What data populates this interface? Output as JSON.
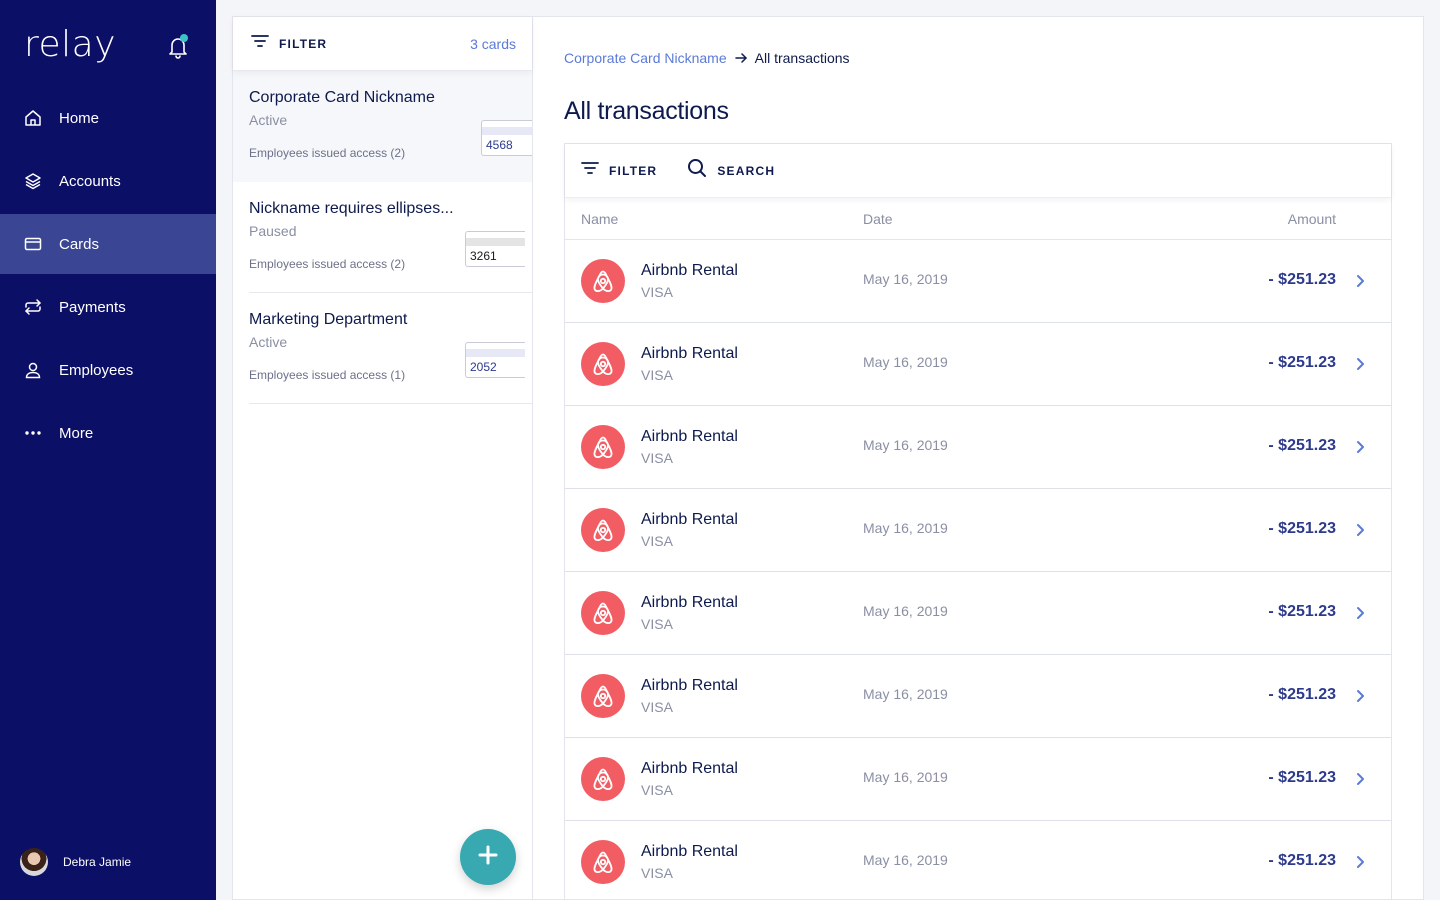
{
  "app": {
    "logo": "relay"
  },
  "sidebar": {
    "items": [
      {
        "label": "Home",
        "icon": "home-icon",
        "active": false
      },
      {
        "label": "Accounts",
        "icon": "layers-icon",
        "active": false
      },
      {
        "label": "Cards",
        "icon": "credit-card-icon",
        "active": true
      },
      {
        "label": "Payments",
        "icon": "swap-arrows-icon",
        "active": false
      },
      {
        "label": "Employees",
        "icon": "user-icon",
        "active": false
      },
      {
        "label": "More",
        "icon": "more-dots-icon",
        "active": false
      }
    ],
    "user": {
      "name": "Debra Jamie"
    }
  },
  "cards_panel": {
    "filter_label": "FILTER",
    "count_label": "3 cards",
    "cards": [
      {
        "title": "Corporate Card Nickname",
        "status": "Active",
        "access": "Employees issued access (2)",
        "last4": "4568"
      },
      {
        "title": "Nickname requires ellipses...",
        "status": "Paused",
        "access": "Employees issued access (2)",
        "last4": "3261"
      },
      {
        "title": "Marketing Department",
        "status": "Active",
        "access": "Employees issued access (1)",
        "last4": "2052"
      }
    ]
  },
  "main": {
    "breadcrumb": {
      "parent": "Corporate Card Nickname",
      "current": "All transactions"
    },
    "title": "All transactions",
    "toolbar": {
      "filter_label": "FILTER",
      "search_label": "SEARCH"
    },
    "columns": {
      "name": "Name",
      "date": "Date",
      "amount": "Amount"
    },
    "transactions": [
      {
        "name": "Airbnb Rental",
        "method": "VISA",
        "date": "May 16, 2019",
        "amount": "- $251.23"
      },
      {
        "name": "Airbnb Rental",
        "method": "VISA",
        "date": "May 16, 2019",
        "amount": "- $251.23"
      },
      {
        "name": "Airbnb Rental",
        "method": "VISA",
        "date": "May 16, 2019",
        "amount": "- $251.23"
      },
      {
        "name": "Airbnb Rental",
        "method": "VISA",
        "date": "May 16, 2019",
        "amount": "- $251.23"
      },
      {
        "name": "Airbnb Rental",
        "method": "VISA",
        "date": "May 16, 2019",
        "amount": "- $251.23"
      },
      {
        "name": "Airbnb Rental",
        "method": "VISA",
        "date": "May 16, 2019",
        "amount": "- $251.23"
      },
      {
        "name": "Airbnb Rental",
        "method": "VISA",
        "date": "May 16, 2019",
        "amount": "- $251.23"
      },
      {
        "name": "Airbnb Rental",
        "method": "VISA",
        "date": "May 16, 2019",
        "amount": "- $251.23"
      }
    ]
  },
  "colors": {
    "sidebar_bg": "#0c0f66",
    "active_nav": "#3a4694",
    "accent": "#5b7ad8",
    "merchant_logo": "#f25c63",
    "fab": "#38a8b1"
  }
}
